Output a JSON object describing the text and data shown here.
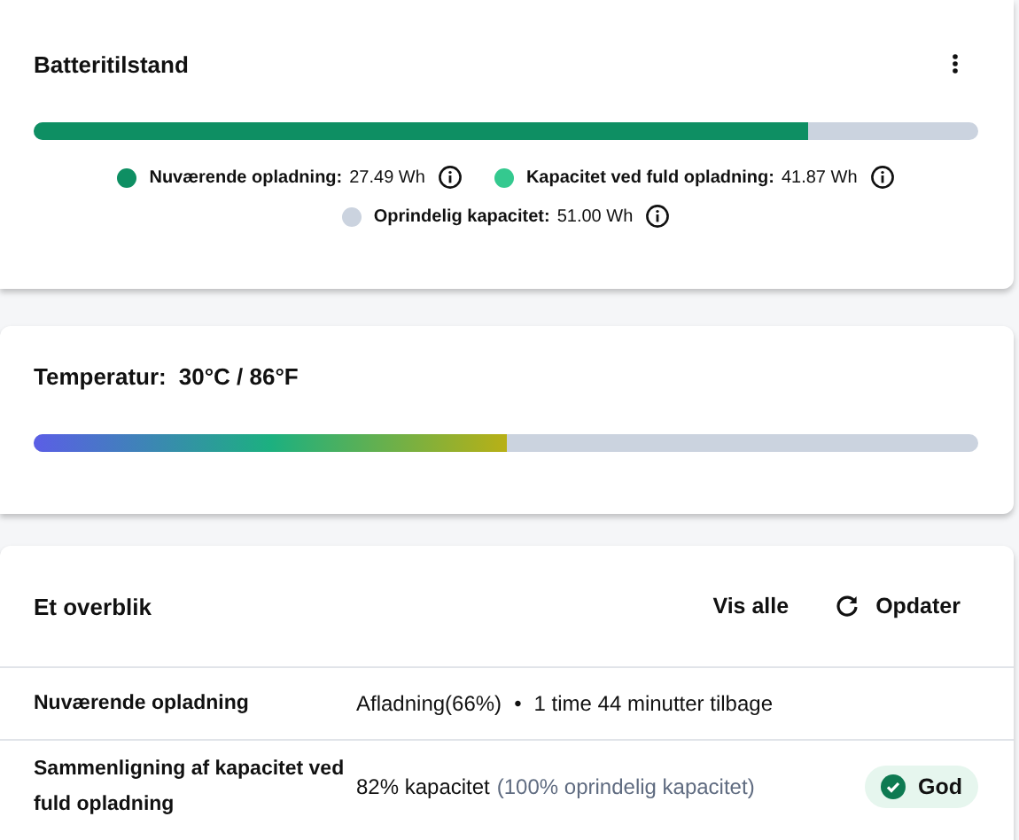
{
  "battery_card": {
    "title": "Batteritilstand",
    "bar": {
      "level": 0.82,
      "color": "#0e8f63"
    },
    "legend": [
      {
        "label": "Nuværende opladning:",
        "value": "27.49 Wh",
        "color": "#0e8f63"
      },
      {
        "label": "Kapacitet ved fuld opladning:",
        "value": "41.87 Wh",
        "color": "#34c98f"
      },
      {
        "label": "Oprindelig kapacitet:",
        "value": "51.00 Wh",
        "color": "#cbd3df"
      }
    ]
  },
  "temperature_card": {
    "label": "Temperatur:",
    "value": "30°C / 86°F",
    "bar": {
      "level": 0.5
    }
  },
  "overview_card": {
    "title": "Et overblik",
    "buttons": [
      {
        "label": "Vis alle",
        "kind": "text"
      },
      {
        "label": "Opdater",
        "kind": "refresh"
      }
    ],
    "rows": [
      {
        "label": "Nuværende opladning",
        "value": "Afladning(66%)",
        "separator": "•",
        "detail": "1 time 44 minutter tilbage"
      },
      {
        "label": "Sammenligning af kapacitet ved fuld opladning",
        "value": "82% kapacitet",
        "note": "(100% oprindelig kapacitet)",
        "badge": {
          "label": "God",
          "kind": "success"
        }
      }
    ]
  }
}
